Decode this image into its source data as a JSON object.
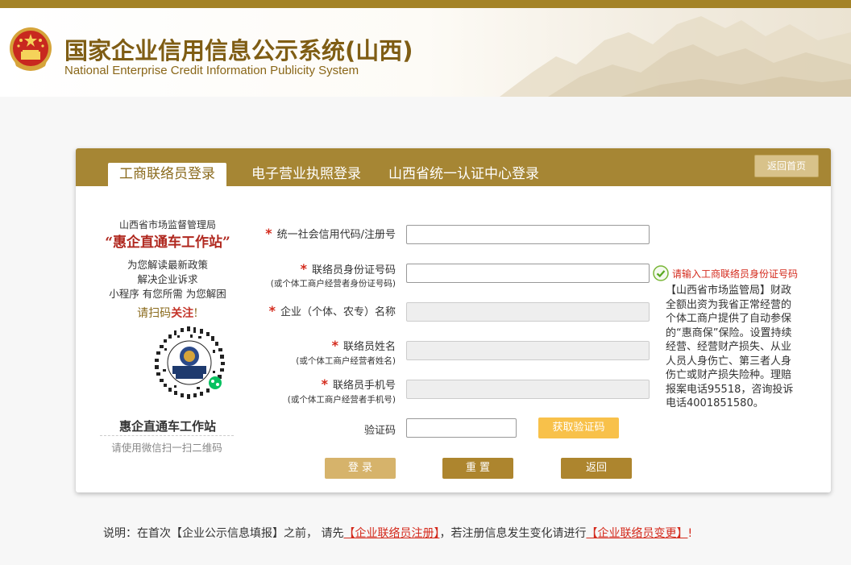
{
  "header": {
    "title_cn": "国家企业信用信息公示系统(山西)",
    "title_en": "National Enterprise Credit Information Publicity System"
  },
  "tabs": [
    {
      "label": "工商联络员登录",
      "active": true
    },
    {
      "label": "电子营业执照登录",
      "active": false
    },
    {
      "label": "山西省统一认证中心登录",
      "active": false
    }
  ],
  "back_home_label": "返回首页",
  "promo": {
    "org": "山西省市场监督管理局",
    "station": "“惠企直通车工作站”",
    "line1": "为您解读最新政策",
    "line2": "解决企业诉求",
    "line3": "小程序 有您所需 为您解困",
    "scan_prefix": "请扫码",
    "scan_emph": "关注",
    "scan_suffix": "!",
    "qr_center": "惠企直通车工作站",
    "qr_name": "惠企直通车工作站",
    "qr_tip": "请使用微信扫一扫二维码"
  },
  "form": {
    "star": "*",
    "credit_code_label": "统一社会信用代码/注册号",
    "credit_code_value": "",
    "id_label": "联络员身份证号码",
    "id_sub": "(或个体工商户经营者身份证号码)",
    "id_value": "",
    "id_hint": "请输入工商联络员身份证号码",
    "name_label": "企业（个体、农专）名称",
    "contact_label": "联络员姓名",
    "contact_sub": "(或个体工商户经营者姓名)",
    "phone_label": "联络员手机号",
    "phone_sub": "(或个体工商户经营者手机号)",
    "captcha_label": "验证码",
    "captcha_value": "",
    "get_code_label": "获取验证码",
    "login_label": "登 录",
    "reset_label": "重 置",
    "back_label": "返回"
  },
  "notice": "【山西省市场监管局】财政全额出资为我省正常经营的个体工商户提供了自动参保的“惠商保”保险。设置持续经营、经营财产损失、从业人员人身伤亡、第三者人身伤亡或财产损失险种。理赔报案电话95518，咨询投诉电话4001851580。",
  "footer_note": {
    "prefix": "说明：在首次【企业公示信息填报】之前， 请先",
    "link1": "【企业联络员注册】",
    "middle": "，若注册信息发生变化请进行",
    "link2": "【企业联络员变更】",
    "suffix": "!"
  },
  "colors": {
    "brand_gold": "#a68634",
    "title_brown": "#7f5d14",
    "required_red": "#d42a1c",
    "get_code_yellow": "#f8c14a"
  }
}
